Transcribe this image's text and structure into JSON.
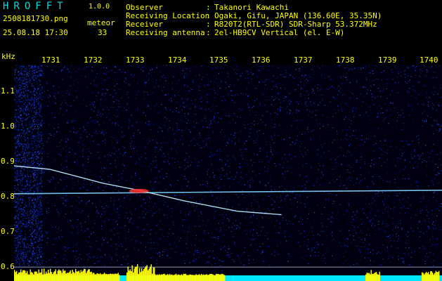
{
  "header": {
    "app_title": "HROFFT",
    "version": "1.0.0",
    "filename": "2508181730.png",
    "datetime": "25.08.18 17:30",
    "meteor_label": "meteor",
    "meteor_count": "33"
  },
  "info": [
    {
      "key": "Observer",
      "value": "Takanori Kawachi"
    },
    {
      "key": "Receiving Location",
      "value": "Ogaki, Gifu, JAPAN (136.60E, 35.35N)"
    },
    {
      "key": "Receiver",
      "value": "R820T2(RTL-SDR) SDR-Sharp 53.372MHz"
    },
    {
      "key": "Receiving antenna",
      "value": "2el-HB9CV Vertical (el. E-W)"
    }
  ],
  "separator": ":",
  "chart_data": {
    "type": "heatmap",
    "ylabel": "kHz",
    "x_ticks": [
      "1731",
      "1732",
      "1733",
      "1734",
      "1735",
      "1736",
      "1737",
      "1738",
      "1739",
      "1740"
    ],
    "y_ticks": [
      "1.1",
      "1.0",
      "0.9",
      "0.8",
      "0.7",
      "0.6"
    ],
    "y_range": [
      0.58,
      1.2
    ],
    "x_range": [
      1730.5,
      1740.1
    ],
    "signals": [
      {
        "kind": "carrier",
        "x": [
          1730.5,
          1740.1
        ],
        "y": [
          0.83,
          0.84
        ]
      },
      {
        "kind": "meteor-echo",
        "x": [
          1730.5,
          1731.3,
          1732.5,
          1733.3,
          1734.3,
          1735.5,
          1736.5
        ],
        "y": [
          0.91,
          0.9,
          0.86,
          0.84,
          0.81,
          0.78,
          0.77
        ]
      },
      {
        "kind": "baseline",
        "x": [
          1730.5,
          1740.1
        ],
        "y": [
          0.62,
          0.62
        ]
      }
    ],
    "colors": {
      "background": "#000010",
      "noise": "#1a3aff",
      "carrier": "#7fd4ff",
      "echo": "#c0f0ff",
      "hot": "#ff3030",
      "bottom_bar": "#00e5ff",
      "peaks": "#ffff00"
    }
  }
}
